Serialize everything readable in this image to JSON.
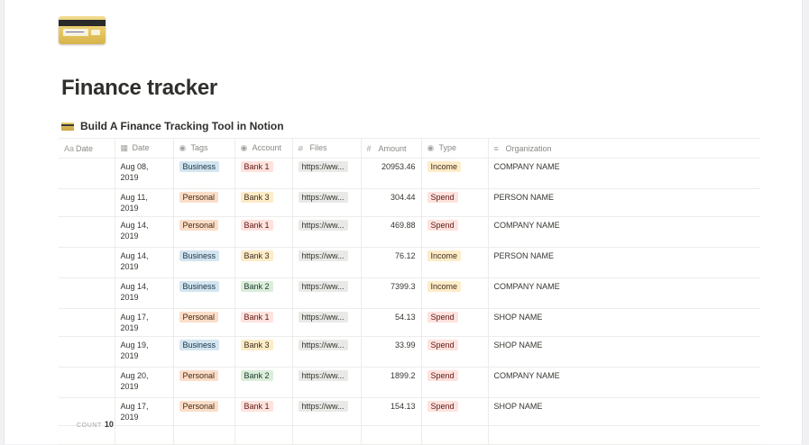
{
  "page": {
    "title": "Finance tracker",
    "database_title": "Build A Finance Tracking Tool in Notion"
  },
  "columns": [
    {
      "label": "Date",
      "icon": "text-property-icon",
      "glyph": "Aa"
    },
    {
      "label": "Date",
      "icon": "calendar-icon",
      "glyph": "▦"
    },
    {
      "label": "Tags",
      "icon": "select-property-icon",
      "glyph": "◉"
    },
    {
      "label": "Account",
      "icon": "select-property-icon",
      "glyph": "◉"
    },
    {
      "label": "Files",
      "icon": "paperclip-icon",
      "glyph": "⌀"
    },
    {
      "label": "Amount",
      "icon": "number-icon",
      "glyph": "#"
    },
    {
      "label": "Type",
      "icon": "select-property-icon",
      "glyph": "◉"
    },
    {
      "label": "Organization",
      "icon": "text-lines-icon",
      "glyph": "≡"
    }
  ],
  "rows": [
    {
      "date2": "Aug 08, 2019",
      "tag": "Business",
      "account": "Bank 1",
      "file": "https://ww...",
      "amount": "20953.46",
      "type": "Income",
      "org": "COMPANY NAME"
    },
    {
      "date2": "Aug 11, 2019",
      "tag": "Personal",
      "account": "Bank 3",
      "file": "https://ww...",
      "amount": "304.44",
      "type": "Spend",
      "org": "PERSON NAME"
    },
    {
      "date2": "Aug 14, 2019",
      "tag": "Personal",
      "account": "Bank 1",
      "file": "https://ww...",
      "amount": "469.88",
      "type": "Spend",
      "org": "COMPANY NAME"
    },
    {
      "date2": "Aug 14, 2019",
      "tag": "Business",
      "account": "Bank 3",
      "file": "https://ww...",
      "amount": "76.12",
      "type": "Income",
      "org": "PERSON NAME"
    },
    {
      "date2": "Aug 14, 2019",
      "tag": "Business",
      "account": "Bank 2",
      "file": "https://ww...",
      "amount": "7399.3",
      "type": "Income",
      "org": "COMPANY NAME"
    },
    {
      "date2": "Aug 17, 2019",
      "tag": "Personal",
      "account": "Bank 1",
      "file": "https://ww...",
      "amount": "54.13",
      "type": "Spend",
      "org": "SHOP NAME"
    },
    {
      "date2": "Aug 19, 2019",
      "tag": "Business",
      "account": "Bank 3",
      "file": "https://ww...",
      "amount": "33.99",
      "type": "Spend",
      "org": "SHOP NAME"
    },
    {
      "date2": "Aug 20, 2019",
      "tag": "Personal",
      "account": "Bank 2",
      "file": "https://ww...",
      "amount": "1899.2",
      "type": "Spend",
      "org": "COMPANY NAME"
    },
    {
      "date2": "Aug 17, 2019",
      "tag": "Personal",
      "account": "Bank 1",
      "file": "https://ww...",
      "amount": "154.13",
      "type": "Spend",
      "org": "SHOP NAME"
    }
  ],
  "row_heights": [
    "tall",
    "short",
    "tall",
    "tall",
    "tall",
    "short",
    "tall",
    "tall",
    "short"
  ],
  "footer": {
    "count_label": "COUNT",
    "count_value": "10"
  },
  "colors": {
    "Business": {
      "bg": "#d3e5ef",
      "fg": "#183347"
    },
    "Personal": {
      "bg": "#fadec9",
      "fg": "#49290e"
    },
    "Bank 1": {
      "bg": "#ffe2dd",
      "fg": "#5d1715"
    },
    "Bank 2": {
      "bg": "#dbeddb",
      "fg": "#1c3829"
    },
    "Bank 3": {
      "bg": "#fdecc8",
      "fg": "#402c1b"
    },
    "Income": {
      "bg": "#fdecc8",
      "fg": "#402c1b"
    },
    "Spend": {
      "bg": "#ffe2dd",
      "fg": "#5d1715"
    }
  }
}
